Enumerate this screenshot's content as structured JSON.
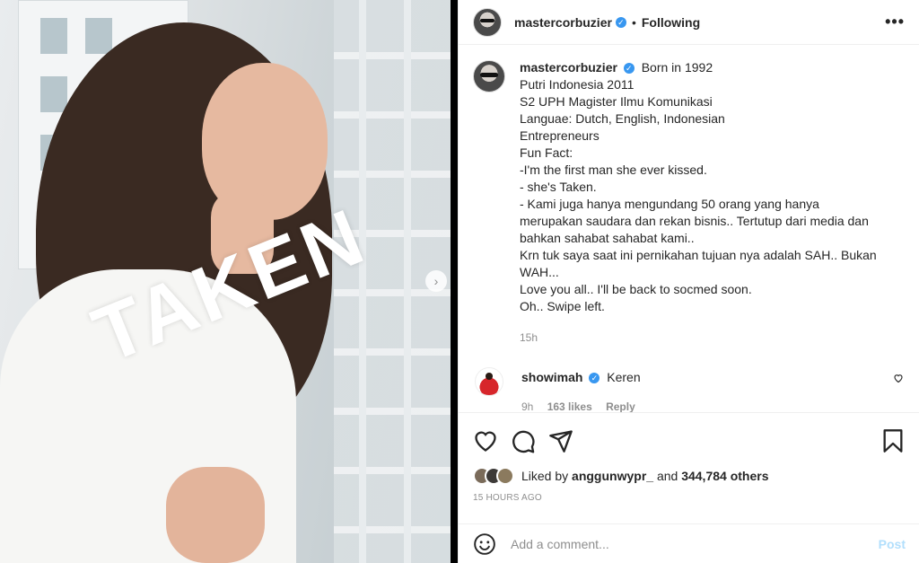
{
  "post": {
    "overlay_text": "TAKEN",
    "next_icon": "chevron-right-icon"
  },
  "header": {
    "username": "mastercorbuzier",
    "separator": "•",
    "follow_status": "Following",
    "more_icon": "more-options-icon"
  },
  "caption": {
    "username": "mastercorbuzier",
    "lines": [
      "Born in 1992",
      "Putri Indonesia 2011",
      "S2 UPH Magister Ilmu Komunikasi",
      "Languae: Dutch, English, Indonesian",
      "Entrepreneurs",
      "Fun Fact:",
      "-I'm the first man she ever kissed.",
      "- she's Taken.",
      "- Kami juga hanya mengundang 50 orang yang hanya",
      "merupakan saudara dan rekan bisnis.. Tertutup dari media dan",
      "bahkan sahabat sahabat kami..",
      "Krn tuk saya saat ini pernikahan tujuan nya adalah SAH.. Bukan",
      "WAH...",
      "Love you all.. I'll be back to socmed soon.",
      "Oh.. Swipe left."
    ],
    "time": "15h"
  },
  "comment": {
    "username": "showimah",
    "text": "Keren",
    "time": "9h",
    "likes": "163 likes",
    "reply": "Reply"
  },
  "likes": {
    "prefix": "Liked by",
    "user": "anggunwypr_",
    "and": "and",
    "others": "344,784 others"
  },
  "timestamp": "15 HOURS AGO",
  "add_comment": {
    "placeholder": "Add a comment...",
    "post_label": "Post"
  },
  "colors": {
    "verified": "#3897f0",
    "post_disabled": "#b2dffc",
    "secondary_text": "#8e8e8e"
  }
}
